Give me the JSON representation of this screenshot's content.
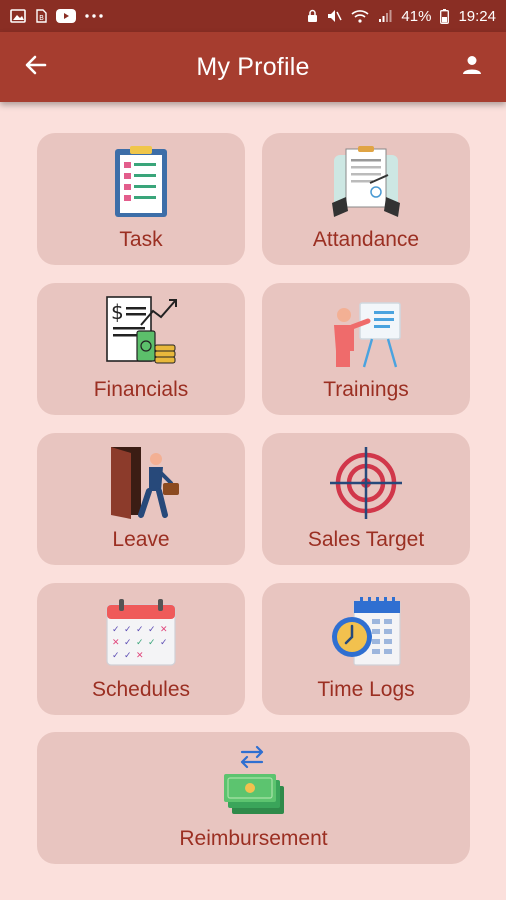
{
  "status_bar": {
    "battery": "41%",
    "time": "19:24"
  },
  "app_bar": {
    "title": "My Profile",
    "back_icon": "arrow-left-icon",
    "profile_icon": "person-icon"
  },
  "colors": {
    "app_bar": "#a63d2f",
    "status_bar": "#8a2e24",
    "background": "#fbe0dc",
    "tile": "#e8c5c0",
    "label": "#9b2f22"
  },
  "tiles": [
    {
      "label": "Task",
      "icon": "clipboard-checklist-icon"
    },
    {
      "label": "Attandance",
      "icon": "attendance-sheet-icon"
    },
    {
      "label": "Financials",
      "icon": "financial-report-icon"
    },
    {
      "label": "Trainings",
      "icon": "presentation-board-icon"
    },
    {
      "label": "Leave",
      "icon": "person-leaving-door-icon"
    },
    {
      "label": "Sales Target",
      "icon": "crosshair-target-icon"
    },
    {
      "label": "Schedules",
      "icon": "calendar-icon"
    },
    {
      "label": "Time Logs",
      "icon": "clock-calendar-icon"
    },
    {
      "label": "Reimbursement",
      "icon": "money-exchange-icon"
    }
  ]
}
